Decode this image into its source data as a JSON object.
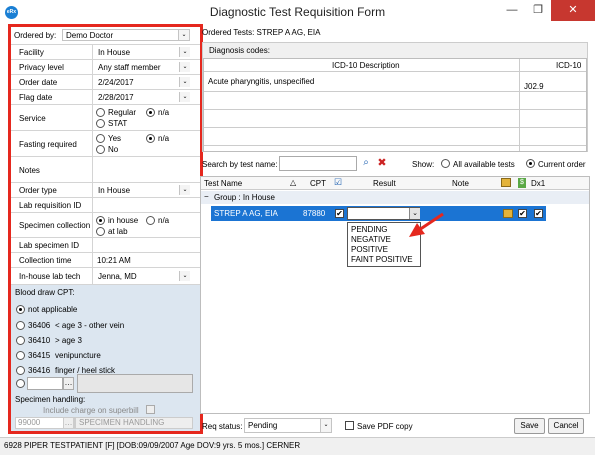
{
  "window": {
    "title": "Diagnostic Test Requisition Form",
    "app_icon": "eRx",
    "minimize": "—",
    "restore": "❐",
    "close": "✕"
  },
  "left": {
    "ordered_by_label": "Ordered by:",
    "ordered_by": "Demo Doctor",
    "facility_label": "Facility",
    "facility": "In House",
    "privacy_label": "Privacy level",
    "privacy": "Any staff member",
    "order_date_label": "Order date",
    "order_date": "2/24/2017",
    "flag_date_label": "Flag date",
    "flag_date": "2/28/2017",
    "service_label": "Service",
    "service_regular": "Regular",
    "service_stat": "STAT",
    "service_na": "n/a",
    "fasting_label": "Fasting required",
    "fasting_yes": "Yes",
    "fasting_no": "No",
    "fasting_na": "n/a",
    "notes_label": "Notes",
    "order_type_label": "Order type",
    "order_type": "In House",
    "lab_req_label": "Lab requisition ID",
    "spec_coll_label": "Specimen collection",
    "spec_inhouse": "in house",
    "spec_na": "n/a",
    "spec_atlab": "at lab",
    "lab_spec_label": "Lab specimen ID",
    "coll_time_label": "Collection time",
    "coll_time": "10:21 AM",
    "tech_label": "In-house lab tech",
    "tech": "Jenna, MD",
    "blood_label": "Blood draw CPT:",
    "cpt_na": "not applicable",
    "cpt1_code": "36406",
    "cpt1_desc": "< age 3 - other vein",
    "cpt2_code": "36410",
    "cpt2_desc": "> age 3",
    "cpt3_code": "36415",
    "cpt3_desc": "venipuncture",
    "cpt4_code": "36416",
    "cpt4_desc": "finger / heel stick",
    "handling_label": "Specimen handling:",
    "superbill_label": "Include charge on superbill",
    "handling_code": "99000",
    "handling_btn": "SPECIMEN HANDLING"
  },
  "right": {
    "ordered_tests": "Ordered Tests: STREP A AG, EIA",
    "dx_label": "Diagnosis codes:",
    "dx_col1": "ICD-10 Description",
    "dx_col2": "ICD-10",
    "dx_desc": "Acute pharyngitis, unspecified",
    "dx_code": "J02.9",
    "search_label": "Search by test name:",
    "show_label": "Show:",
    "show_all": "All available tests",
    "show_current": "Current order",
    "col_test": "Test Name",
    "col_cpt": "CPT",
    "col_result": "Result",
    "col_note": "Note",
    "col_dx": "Dx1",
    "group_label": "Group : In House",
    "test_name": "STREP A AG, EIA",
    "test_cpt": "87880",
    "dropdown_options": [
      "PENDING",
      "NEGATIVE",
      "POSITIVE",
      "FAINT POSITIVE"
    ],
    "req_status_label": "Req status:",
    "req_status": "Pending",
    "save_pdf": "Save PDF copy",
    "save": "Save",
    "cancel": "Cancel"
  },
  "status": {
    "patient": "6928 PIPER TESTPATIENT [F] [DOB:09/09/2007  Age DOV:9 yrs. 5 mos.] CERNER"
  },
  "colors": {
    "highlight": "#e5281e",
    "selected_row": "#1b74d3",
    "group_row": "#e9eef5"
  }
}
